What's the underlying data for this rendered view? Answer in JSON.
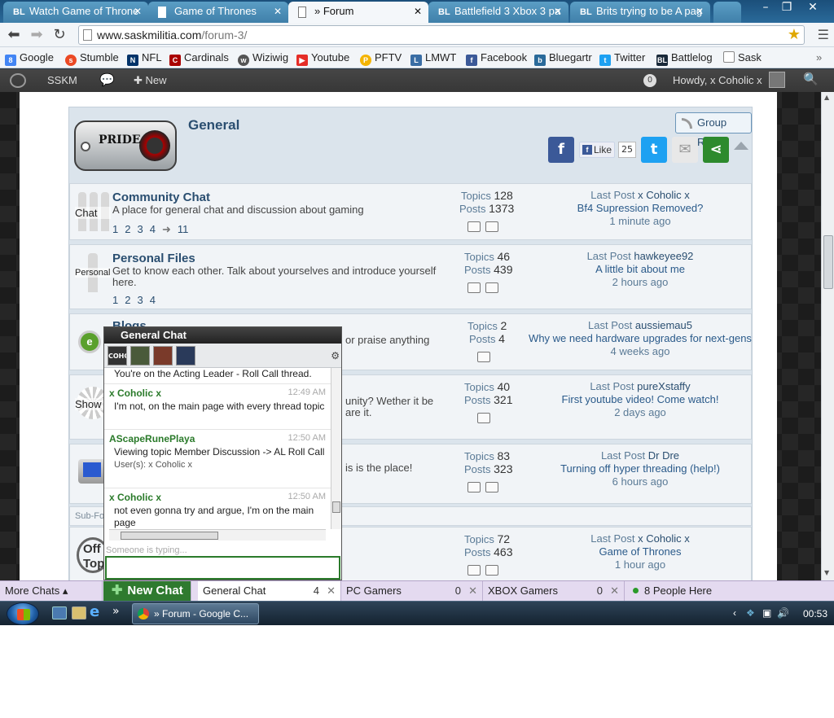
{
  "browser": {
    "tabs": [
      {
        "label": "Watch Game of Throne",
        "icon": "bl-icon",
        "active": false
      },
      {
        "label": "Game of Thrones",
        "icon": "page-icon",
        "active": false
      },
      {
        "label": "» Forum",
        "icon": "page-icon",
        "active": true
      },
      {
        "label": "Battlefield 3 Xbox 3 pa",
        "icon": "bl-icon",
        "active": false
      },
      {
        "label": "Brits trying to be A pag",
        "icon": "bl-icon",
        "active": false
      }
    ],
    "close_glyph": "✕",
    "url_host": "www.saskmilitia.com",
    "url_path": "/forum-3/",
    "bookmarks": [
      {
        "label": "Google",
        "color": "#4285f4"
      },
      {
        "label": "Stumble",
        "color": "#eb4924"
      },
      {
        "label": "NFL",
        "color": "#013369"
      },
      {
        "label": "Cardinals",
        "color": "#a00"
      },
      {
        "label": "Wiziwig",
        "color": "#555"
      },
      {
        "label": "Youtube",
        "color": "#e52d27"
      },
      {
        "label": "PFTV",
        "color": "#f4b400"
      },
      {
        "label": "LMWT",
        "color": "#3a6ea5"
      },
      {
        "label": "Facebook",
        "color": "#3b5998"
      },
      {
        "label": "Bluegartr",
        "color": "#2a6a9a"
      },
      {
        "label": "Twitter",
        "color": "#1da1f2"
      },
      {
        "label": "Battlelog",
        "color": "#1a2a3a"
      },
      {
        "label": "Sask",
        "color": "#888"
      }
    ],
    "bookmarks_more": "»"
  },
  "adminbar": {
    "site": "SSKM",
    "new_label": "New",
    "notifications": "0",
    "howdy": "Howdy, x Coholic x"
  },
  "group": {
    "logo_text": "PRIDE",
    "name": "General",
    "rss_label": "Group RSS",
    "like_label": "Like",
    "like_count": "25"
  },
  "forums": [
    {
      "title": "Community Chat",
      "icon_label": "Chat",
      "description": "A place for general chat and discussion about gaming",
      "pages": [
        "1",
        "2",
        "3",
        "4",
        "➜",
        "11"
      ],
      "topics_label": "Topics",
      "topics": "128",
      "posts_label": "Posts",
      "posts": "1373",
      "last_post_label": "Last Post",
      "last_user": "x Coholic x",
      "last_title": "Bf4 Supression Removed?",
      "last_ago": "1 minute ago"
    },
    {
      "title": "Personal Files",
      "icon_label": "Personal",
      "description": "Get to know each other. Talk about yourselves and introduce yourself here.",
      "pages": [
        "1",
        "2",
        "3",
        "4"
      ],
      "topics_label": "Topics",
      "topics": "46",
      "posts_label": "Posts",
      "posts": "439",
      "last_post_label": "Last Post",
      "last_user": "hawkeyee92",
      "last_title": "A little bit about me",
      "last_ago": "2 hours ago"
    },
    {
      "title": "Blogs",
      "icon_label": "",
      "description": "or praise anything",
      "pages": [],
      "topics_label": "Topics",
      "topics": "2",
      "posts_label": "Posts",
      "posts": "4",
      "last_post_label": "Last Post",
      "last_user": "aussiemau5",
      "last_title": "Why we need hardware upgrades for next-gens",
      "last_ago": "4 weeks ago"
    },
    {
      "title": "",
      "icon_label": "Show",
      "description": "unity? Wether it be",
      "description2": "are it.",
      "pages": [],
      "topics_label": "Topics",
      "topics": "40",
      "posts_label": "Posts",
      "posts": "321",
      "last_post_label": "Last Post",
      "last_user": "pureXstaffy",
      "last_title": "First youtube video! Come watch!",
      "last_ago": "2 days ago"
    },
    {
      "title": "",
      "icon_label": "",
      "description": "is is the place!",
      "pages": [],
      "topics_label": "Topics",
      "topics": "83",
      "posts_label": "Posts",
      "posts": "323",
      "last_post_label": "Last Post",
      "last_user": "Dr Dre",
      "last_title": "Turning off hyper threading (help!)",
      "last_ago": "6 hours ago"
    },
    {
      "title": "",
      "icon_label": "Off Topic",
      "description": "",
      "pages": [],
      "topics_label": "Topics",
      "topics": "72",
      "posts_label": "Posts",
      "posts": "463",
      "last_post_label": "Last Post",
      "last_user": "x Coholic x",
      "last_title": "Game of Thrones",
      "last_ago": "1 hour ago"
    }
  ],
  "subforum_label": "Sub-Fo",
  "chat": {
    "title": "General Chat",
    "avatars": [
      {
        "label": "COHC",
        "color": "#333"
      },
      {
        "label": "",
        "color": "#4a5a3a"
      },
      {
        "label": "",
        "color": "#7a3a2a"
      },
      {
        "label": "",
        "color": "#2a3a5a"
      }
    ],
    "clipped_line": "You're on the Acting Leader - Roll Call thread.",
    "messages": [
      {
        "user": "x Coholic x",
        "time": "12:49 AM",
        "text": "I'm not, on the main page with every thread topic"
      },
      {
        "user": "AScapeRunePlaya",
        "time": "12:50 AM",
        "text": "Viewing topic Member Discussion -> AL Roll Call",
        "text2": "User(s): x Coholic x"
      },
      {
        "user": "x Coholic x",
        "time": "12:50 AM",
        "text": "not even gonna try and argue, I'm on the main page"
      }
    ],
    "typing": "Someone is typing...",
    "input_value": ""
  },
  "chatbar": {
    "more_chats": "More Chats",
    "new_chat": "New Chat",
    "rooms": [
      {
        "label": "General Chat",
        "count": "4"
      },
      {
        "label": "PC Gamers",
        "count": "0"
      },
      {
        "label": "XBOX Gamers",
        "count": "0"
      }
    ],
    "people_here": "8 People Here"
  },
  "taskbar": {
    "more": "»",
    "task_label": "» Forum - Google C...",
    "clock": "00:53"
  }
}
